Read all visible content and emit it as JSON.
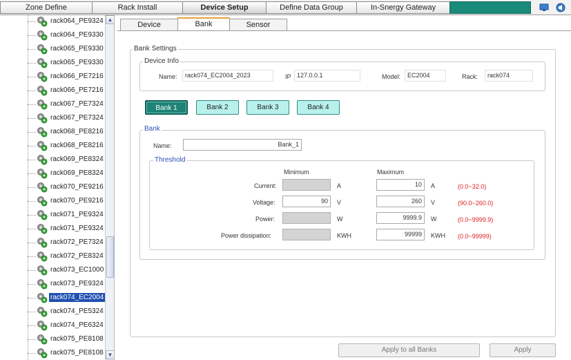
{
  "top_menu": {
    "items": [
      "Zone Define",
      "Rack Install",
      "Device Setup",
      "Define Data Group",
      "In-Snergy Gateway"
    ]
  },
  "tree": {
    "items": [
      "rack064_PE9324",
      "rack064_PE9330",
      "rack065_PE9330",
      "rack065_PE9330",
      "rack066_PE7216",
      "rack066_PE7216",
      "rack067_PE7324",
      "rack067_PE7324",
      "rack068_PE8216",
      "rack068_PE8216",
      "rack069_PE8324",
      "rack069_PE8324",
      "rack070_PE9216",
      "rack070_PE9216",
      "rack071_PE9324",
      "rack071_PE9324",
      "rack072_PE7324",
      "rack072_PE8324",
      "rack073_EC1000",
      "rack073_PE9324",
      "rack074_EC2004",
      "rack074_PE5324",
      "rack074_PE6324",
      "rack075_PE8108",
      "rack075_PE8108"
    ],
    "selected_index": 20
  },
  "tabs": [
    "Device",
    "Bank",
    "Sensor"
  ],
  "bank_settings": {
    "title": "Bank Settings",
    "device_info": {
      "title": "Device Info",
      "name_label": "Name:",
      "name_value": "rack074_EC2004_2023",
      "ip_label": "IP",
      "ip_value": "127.0.0.1",
      "model_label": "Model:",
      "model_value": "EC2004",
      "rack_label": "Rack:",
      "rack_value": "rack074"
    },
    "bank_buttons": [
      "Bank 1",
      "Bank 2",
      "Bank 3",
      "Bank 4"
    ],
    "bank": {
      "title": "Bank",
      "name_label": "Name:",
      "name_value": "Bank_1",
      "threshold": {
        "title": "Threshold",
        "minimum_header": "Minimum",
        "maximum_header": "Maximum",
        "rows": [
          {
            "label": "Current:",
            "min": "",
            "min_unit": "A",
            "max": "10",
            "max_unit": "A",
            "range": "(0.0~32.0)"
          },
          {
            "label": "Voltage:",
            "min": "90",
            "min_unit": "V",
            "max": "260",
            "max_unit": "V",
            "range": "(90.0~260.0)"
          },
          {
            "label": "Power:",
            "min": "",
            "min_unit": "W",
            "max": "9999.9",
            "max_unit": "W",
            "range": "(0.0~9999.9)"
          },
          {
            "label": "Power dissipation:",
            "min": "",
            "min_unit": "KWH",
            "max": "99999",
            "max_unit": "KWH",
            "range": "(0.0~99999)"
          }
        ]
      }
    }
  },
  "buttons": {
    "apply_all": "Apply to all Banks",
    "apply": "Apply"
  },
  "colors": {
    "accent_teal": "#1f8378",
    "bank_button_bg": "#b8f0ec",
    "range_red": "#e02020",
    "selection_blue": "#1f4fb0"
  }
}
